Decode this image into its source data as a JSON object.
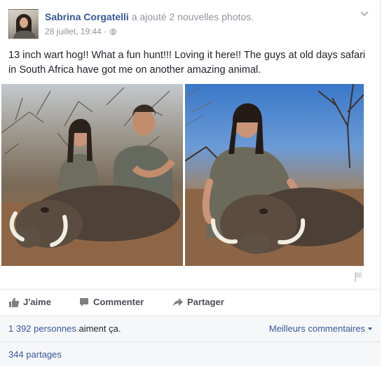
{
  "post": {
    "author": "Sabrina Corgatelli",
    "action": "a ajouté 2 nouvelles photos.",
    "timestamp": "28 juillet, 19:44 ·",
    "privacy_icon": "globe-icon",
    "text": "13 inch wart hog!! What a fun hunt!!! Loving it here!! The guys at old days safari in South Africa have got me on another amazing animal."
  },
  "actions": {
    "like": "J'aime",
    "comment": "Commenter",
    "share": "Partager"
  },
  "footer": {
    "likes_count": "1 392 personnes",
    "likes_suffix": " aiment ça.",
    "best_comments": "Meilleurs commentaires",
    "shares": "344 partages"
  },
  "colors": {
    "link": "#365899",
    "meta": "#90949c",
    "footer_bg": "#f6f7f9"
  }
}
